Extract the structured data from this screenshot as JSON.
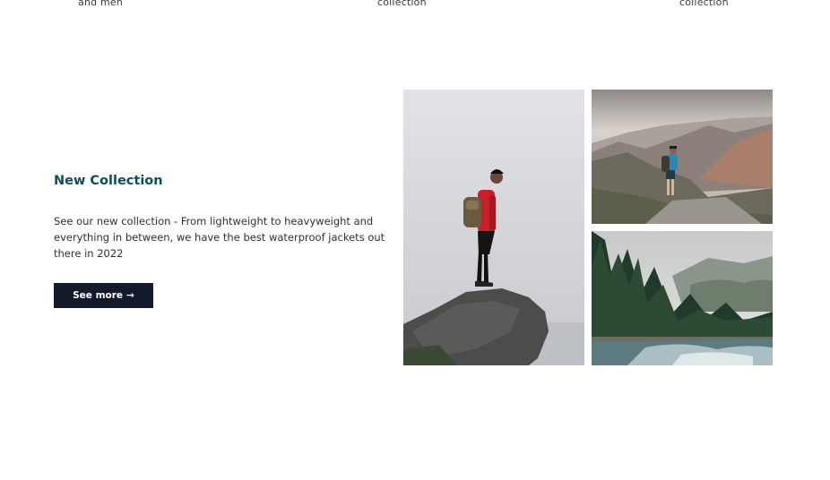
{
  "top_captions": [
    "and men",
    "collection",
    "collection"
  ],
  "collection": {
    "title": "New Collection",
    "description": "See our new collection - From lightweight to heavyweight and everything in between, we have the best waterproof jackets out there in 2022",
    "button_label": "See more",
    "button_icon": "arrow-right-icon"
  },
  "colors": {
    "title": "#0b4f5c",
    "button_bg": "#131a2c",
    "button_text": "#ffffff",
    "jacket": "#c8202a"
  }
}
